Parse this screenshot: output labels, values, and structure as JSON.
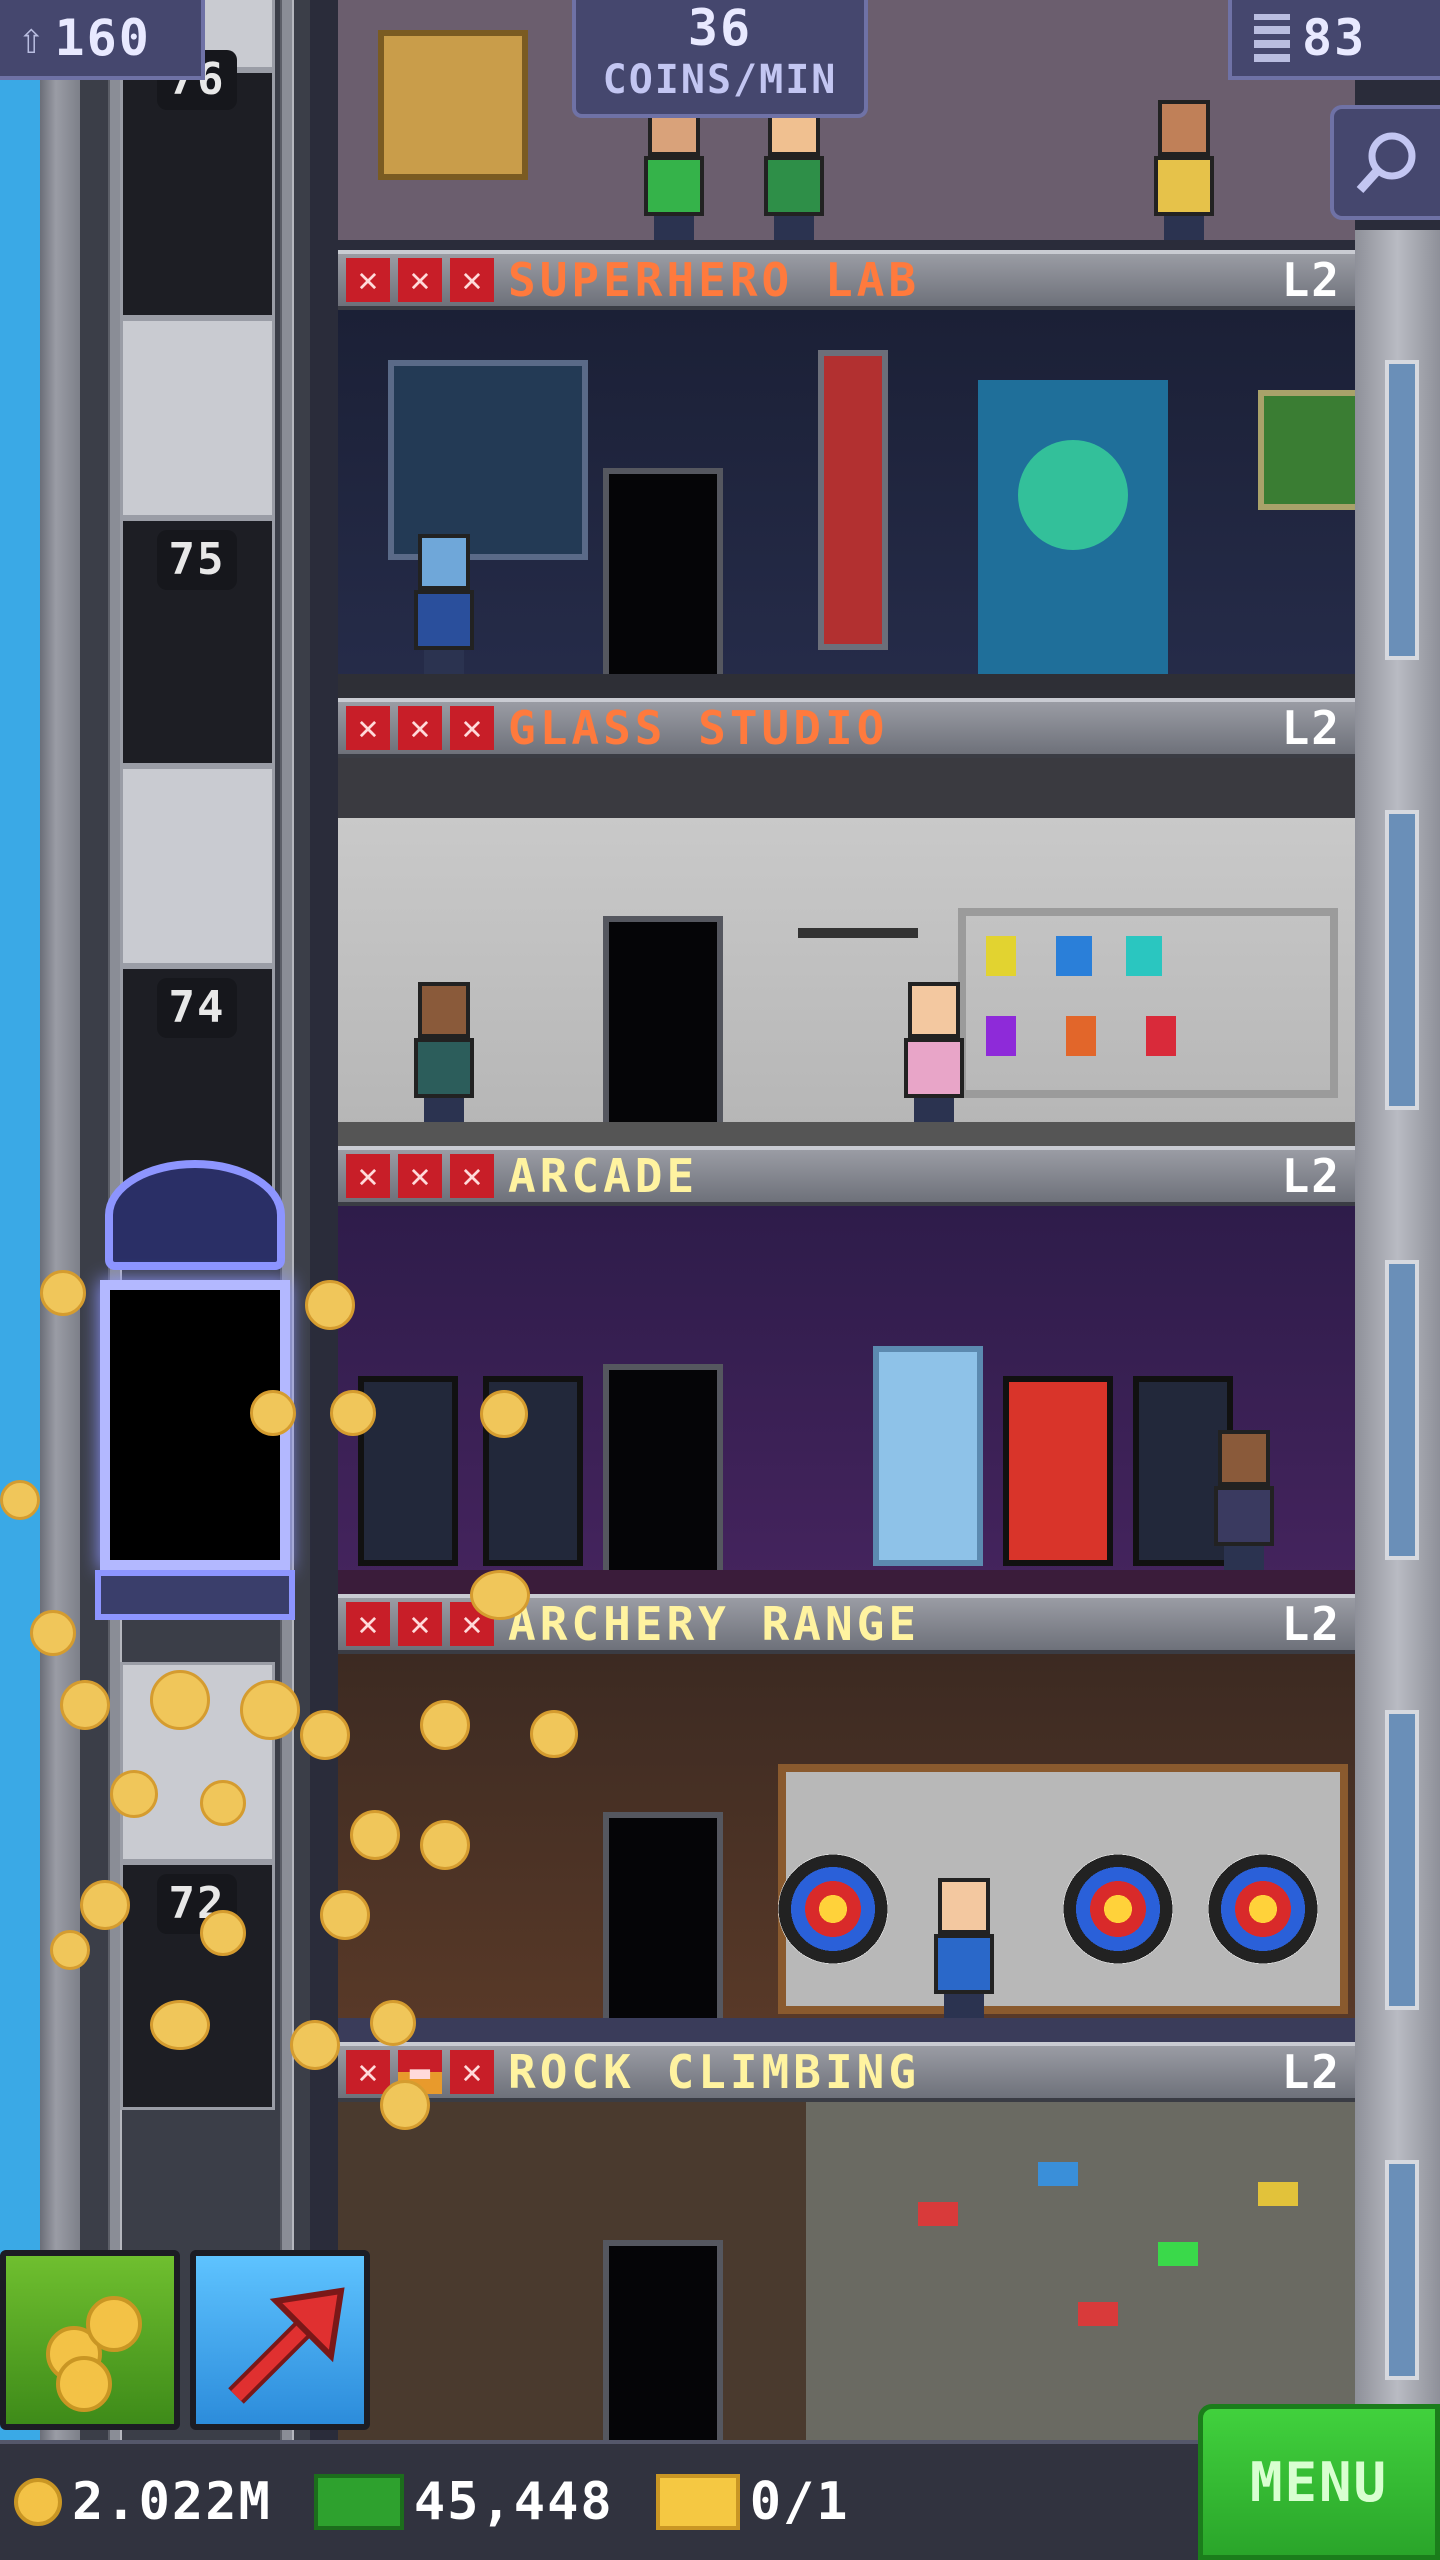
{
  "hud": {
    "population": "160",
    "coins_per_min_value": "36",
    "coins_per_min_label": "COINS/MIN",
    "floors_count": "83"
  },
  "shaft": {
    "floor_numbers": [
      "76",
      "75",
      "74",
      "72"
    ]
  },
  "floors": [
    {
      "name": "SUPERHERO LAB",
      "level": "L2",
      "name_color": "#ff7a3d"
    },
    {
      "name": "GLASS STUDIO",
      "level": "L2",
      "name_color": "#ff7a3d"
    },
    {
      "name": "ARCADE",
      "level": "L2",
      "name_color": "#fff3a0"
    },
    {
      "name": "ARCHERY RANGE",
      "level": "L2",
      "name_color": "#fff3a0"
    },
    {
      "name": "ROCK CLIMBING",
      "level": "L2",
      "name_color": "#fff3a0"
    }
  ],
  "bottom_bar": {
    "coins": "2.022M",
    "bux": "45,448",
    "tickets": "0/1",
    "menu_label": "MENU"
  },
  "colors": {
    "sky": "#3aa9e6",
    "hud_bg": "#45476e",
    "menu_green": "#34c233",
    "star_red": "#c81e28",
    "coin_gold": "#f3c246"
  }
}
